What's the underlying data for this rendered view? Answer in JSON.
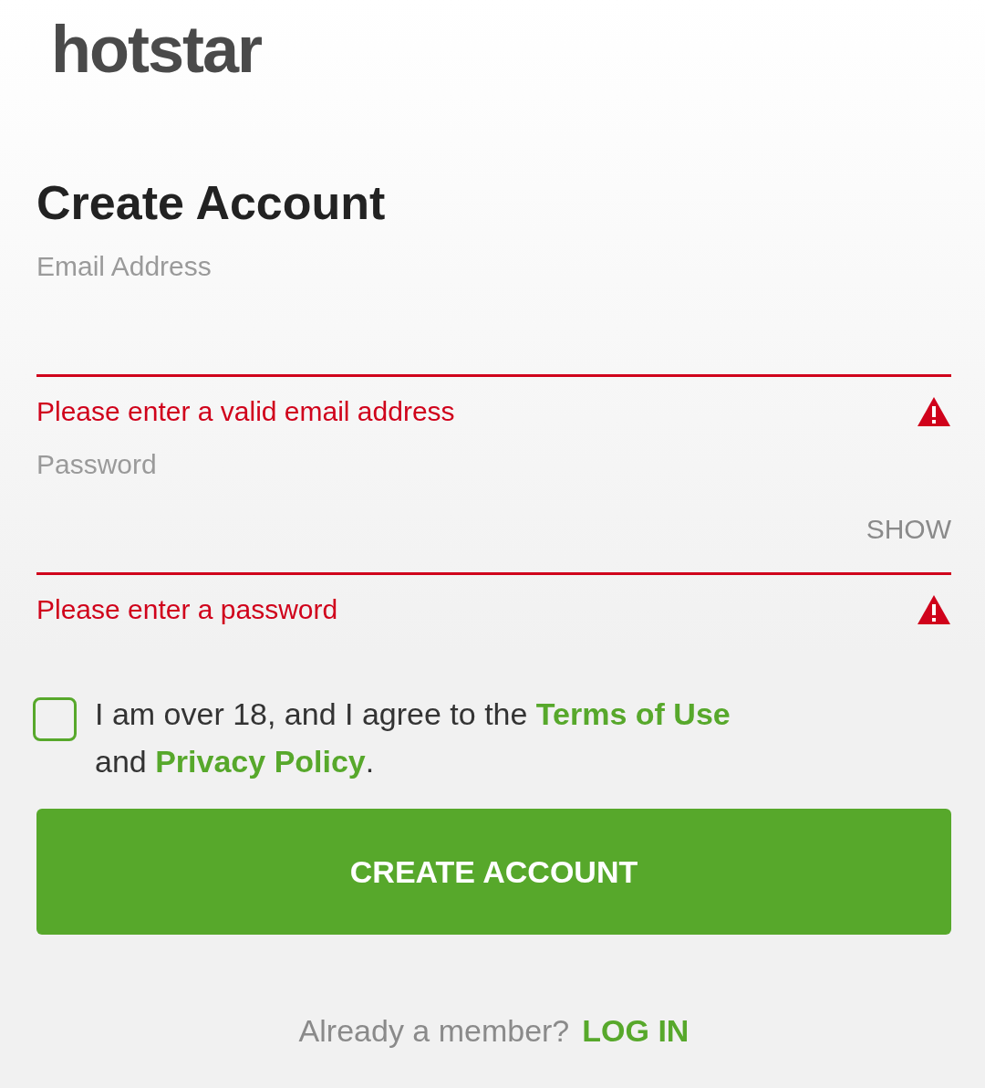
{
  "logo": "hotstar",
  "title": "Create Account",
  "fields": [
    {
      "label": "Email Address",
      "invalid": true,
      "error": "Please enter a valid email address"
    },
    {
      "label": "Password",
      "toggle": "SHOW",
      "invalid": true,
      "error": "Please enter a password"
    }
  ],
  "agreement": {
    "checked": false,
    "lines": [
      [
        {
          "text": "I am over 18, and I agree to the ",
          "link": false
        },
        {
          "text": "Terms of Use",
          "link": true
        }
      ],
      [
        {
          "text": "and ",
          "link": false
        },
        {
          "text": "Privacy Policy",
          "link": true
        },
        {
          "text": ".",
          "link": false
        }
      ]
    ]
  },
  "submit": "CREATE ACCOUNT",
  "footer": {
    "prompt": "Already a member?",
    "link": "LOG IN"
  }
}
